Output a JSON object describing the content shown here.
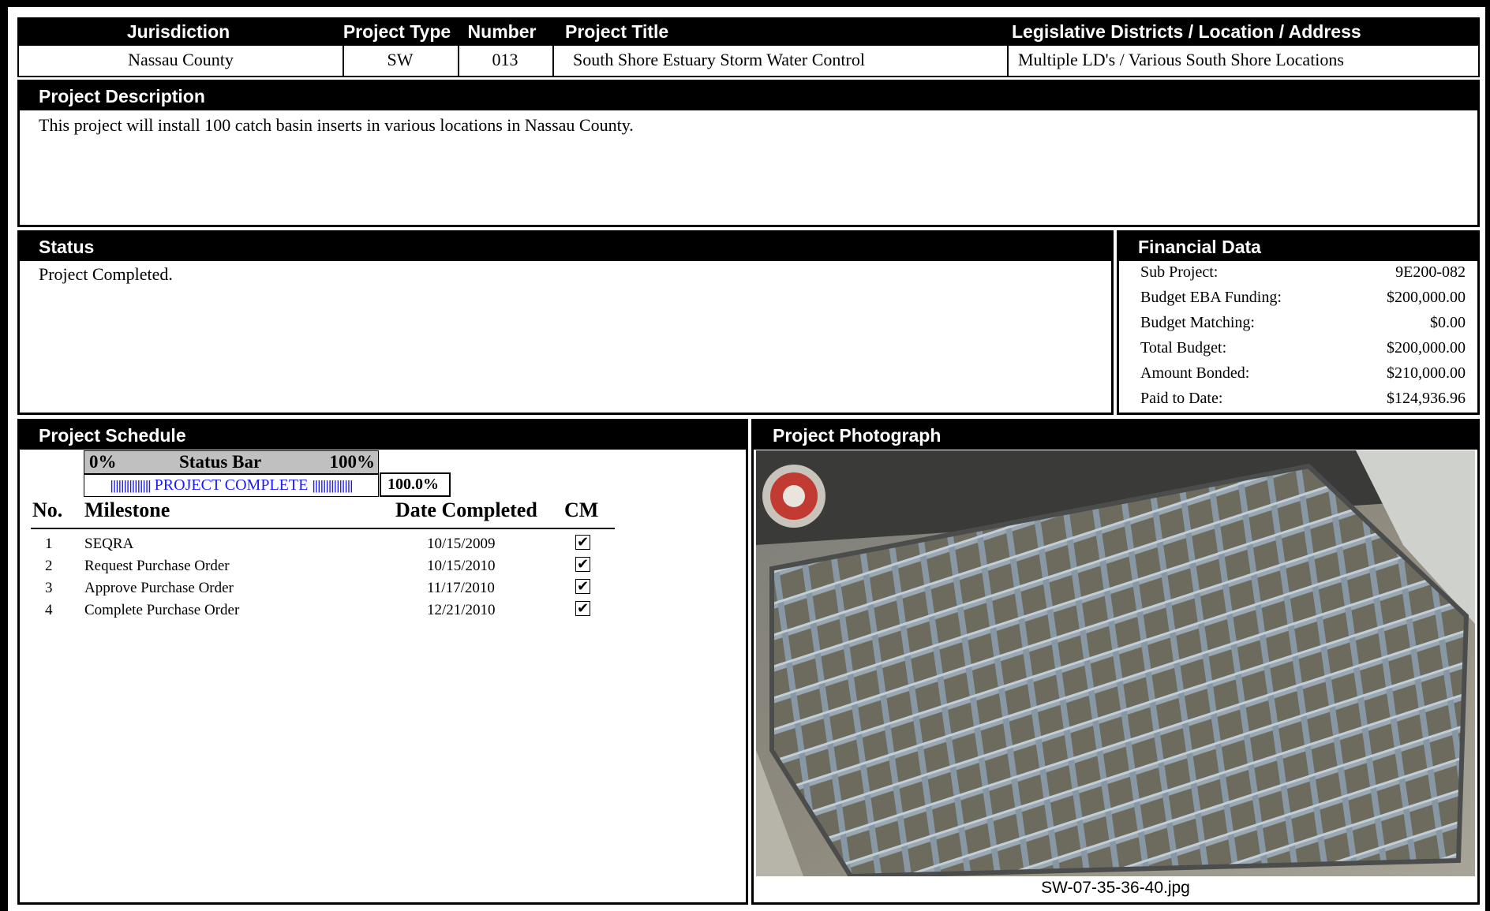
{
  "top_table": {
    "headers": {
      "jurisdiction": "Jurisdiction",
      "project_type": "Project Type",
      "number": "Number",
      "project_title": "Project Title",
      "location": "Legislative Districts / Location / Address"
    },
    "values": {
      "jurisdiction": "Nassau County",
      "project_type": "SW",
      "number": "013",
      "project_title": "South Shore Estuary Storm Water Control",
      "location": "Multiple LD's / Various South Shore Locations"
    }
  },
  "description": {
    "header": "Project Description",
    "text": "This project will install 100 catch basin inserts in various locations in Nassau County."
  },
  "status": {
    "header": "Status",
    "text": "Project Completed."
  },
  "financial": {
    "header": "Financial Data",
    "rows": [
      {
        "label": "Sub Project:",
        "value": "9E200-082"
      },
      {
        "label": "Budget EBA Funding:",
        "value": "$200,000.00"
      },
      {
        "label": "Budget Matching:",
        "value": "$0.00"
      },
      {
        "label": "Total Budget:",
        "value": "$200,000.00"
      },
      {
        "label": "Amount Bonded:",
        "value": "$210,000.00"
      },
      {
        "label": "Paid to Date:",
        "value": "$124,936.96"
      }
    ]
  },
  "schedule": {
    "header": "Project Schedule",
    "status_bar": {
      "min_label": "0%",
      "title": "Status Bar",
      "max_label": "100%",
      "fill_text": "PROJECT COMPLETE",
      "progress": 1.0,
      "percent_text": "100.0%"
    },
    "columns": {
      "no": "No.",
      "milestone": "Milestone",
      "date": "Date Completed",
      "cm": "CM"
    },
    "milestones": [
      {
        "no": "1",
        "name": "SEQRA",
        "date": "10/15/2009",
        "cm": true
      },
      {
        "no": "2",
        "name": "Request Purchase Order",
        "date": "10/15/2010",
        "cm": true
      },
      {
        "no": "3",
        "name": "Approve Purchase Order",
        "date": "11/17/2010",
        "cm": true
      },
      {
        "no": "4",
        "name": "Complete Purchase Order",
        "date": "12/21/2010",
        "cm": true
      }
    ]
  },
  "photo": {
    "header": "Project Photograph",
    "caption": "SW-07-35-36-40.jpg"
  }
}
